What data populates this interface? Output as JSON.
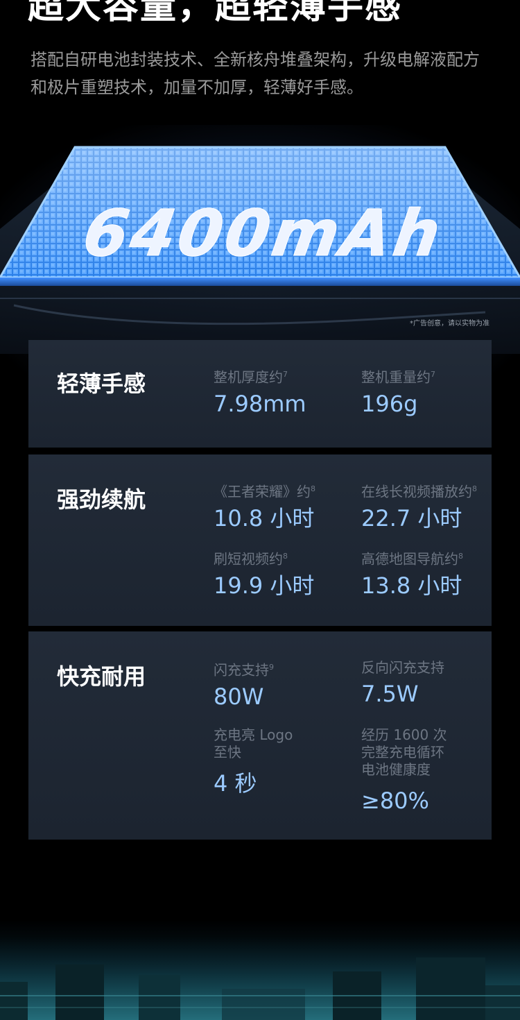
{
  "page": {
    "headline": "超大容量，超轻薄手感",
    "intro": "搭配自研电池封装技术、全新核舟堆叠架构，升级电解液配方和极片重塑技术，加量不加厚，轻薄好手感。"
  },
  "hero": {
    "capacity_text": "6400mAh",
    "caption": "*广告创意，请以实物为准"
  },
  "cards": [
    {
      "title": "轻薄手感",
      "stats": [
        {
          "label": "整机厚度约",
          "sup": "7",
          "value": "7.98mm"
        },
        {
          "label": "整机重量约",
          "sup": "7",
          "value": "196g"
        }
      ]
    },
    {
      "title": "强劲续航",
      "stats": [
        {
          "label": "《王者荣耀》约",
          "sup": "8",
          "value": "10.8 小时"
        },
        {
          "label": "在线长视频播放约",
          "sup": "8",
          "value": "22.7 小时"
        },
        {
          "label": "刷短视频约",
          "sup": "8",
          "value": "19.9 小时"
        },
        {
          "label": "高德地图导航约",
          "sup": "8",
          "value": "13.8 小时"
        }
      ]
    },
    {
      "title": "快充耐用",
      "stats": [
        {
          "label": "闪充支持",
          "sup": "9",
          "value": "80W"
        },
        {
          "label": "反向闪充支持",
          "sup": "",
          "value": "7.5W"
        },
        {
          "label": "充电亮 Logo\n至快",
          "sup": "",
          "value": "4 秒"
        },
        {
          "label": "经历 1600 次\n完整充电循环\n电池健康度",
          "sup": "",
          "value": "≥80%"
        }
      ]
    }
  ],
  "colors": {
    "accent": "#9ccbff",
    "muted_label": "#6d7683",
    "card_bg": "#1f2733",
    "battery_grid": "#2e86f0"
  }
}
